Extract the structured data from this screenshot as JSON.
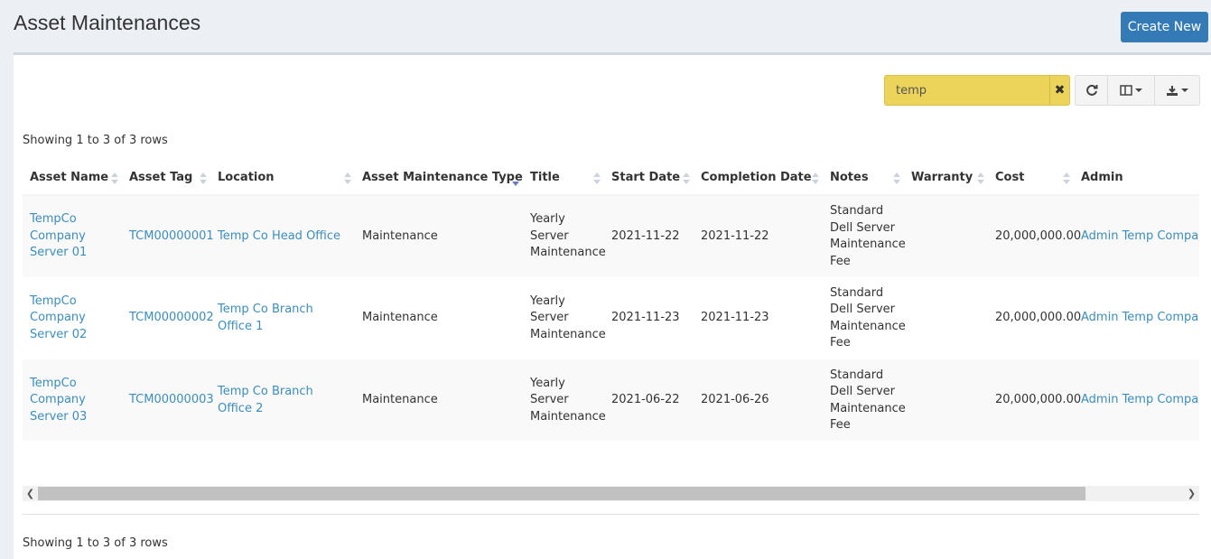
{
  "page": {
    "title": "Asset Maintenances"
  },
  "header": {
    "create_label": "Create New"
  },
  "toolbar": {
    "search_value": "temp",
    "clear_icon": "times-icon",
    "refresh_icon": "refresh-icon",
    "columns_icon": "columns-icon",
    "export_icon": "download-icon"
  },
  "pagination": {
    "showing_text": "Showing 1 to 3 of 3 rows"
  },
  "table": {
    "sorted_column": "Asset Maintenance Type",
    "columns": [
      "Asset Name",
      "Asset Tag",
      "Location",
      "Asset Maintenance Type",
      "Title",
      "Start Date",
      "Completion Date",
      "Notes",
      "Warranty",
      "Cost",
      "Admin"
    ],
    "rows": [
      {
        "asset_name": "TempCo Company Server 01",
        "asset_tag": "TCM00000001",
        "location": "Temp Co Head Office",
        "type": "Maintenance",
        "title": "Yearly Server Maintenance",
        "start_date": "2021-11-22",
        "completion_date": "2021-11-22",
        "notes": "Standard Dell Server Maintenance Fee",
        "warranty": "",
        "cost": "20,000,000.00",
        "admin": "Admin Temp Company"
      },
      {
        "asset_name": "TempCo Company Server 02",
        "asset_tag": "TCM00000002",
        "location": "Temp Co Branch Office 1",
        "type": "Maintenance",
        "title": "Yearly Server Maintenance",
        "start_date": "2021-11-23",
        "completion_date": "2021-11-23",
        "notes": "Standard Dell Server Maintenance Fee",
        "warranty": "",
        "cost": "20,000,000.00",
        "admin": "Admin Temp Company"
      },
      {
        "asset_name": "TempCo Company Server 03",
        "asset_tag": "TCM00000003",
        "location": "Temp Co Branch Office 2",
        "type": "Maintenance",
        "title": "Yearly Server Maintenance",
        "start_date": "2021-06-22",
        "completion_date": "2021-06-26",
        "notes": "Standard Dell Server Maintenance Fee",
        "warranty": "",
        "cost": "20,000,000.00",
        "admin": "Admin Temp Company"
      }
    ]
  },
  "colors": {
    "accent": "#3c8dbc",
    "search_bg": "#ecd35a",
    "button": "#337ab7"
  }
}
